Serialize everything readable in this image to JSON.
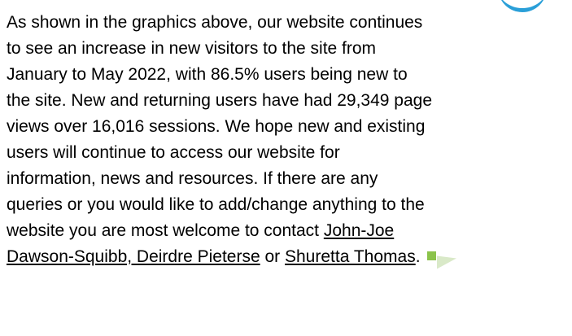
{
  "paragraph": {
    "lines": [
      "As shown in the graphics above, our website continues",
      "to see an increase in new visitors to the site from",
      "January to May 2022, with 86.5% users being new to",
      "the site. New and returning users have had 29,349 page",
      "views over 16,016 sessions. We hope new and existing",
      "users will continue to access our website for",
      "information, news and resources. If there are any",
      "queries or you would like to add/change anything to the",
      "website you are most welcome to contact "
    ],
    "link_john_joe_part1": "John-Joe",
    "link_john_joe_part2": "Dawson-Squibb, Deirdre Pieterse",
    "connector_or": " or ",
    "link_shuretta": "Shuretta Thomas",
    "final_period": "."
  },
  "colors": {
    "accent_blue": "#2a9fd8",
    "end_mark_green": "#8bc34a"
  }
}
